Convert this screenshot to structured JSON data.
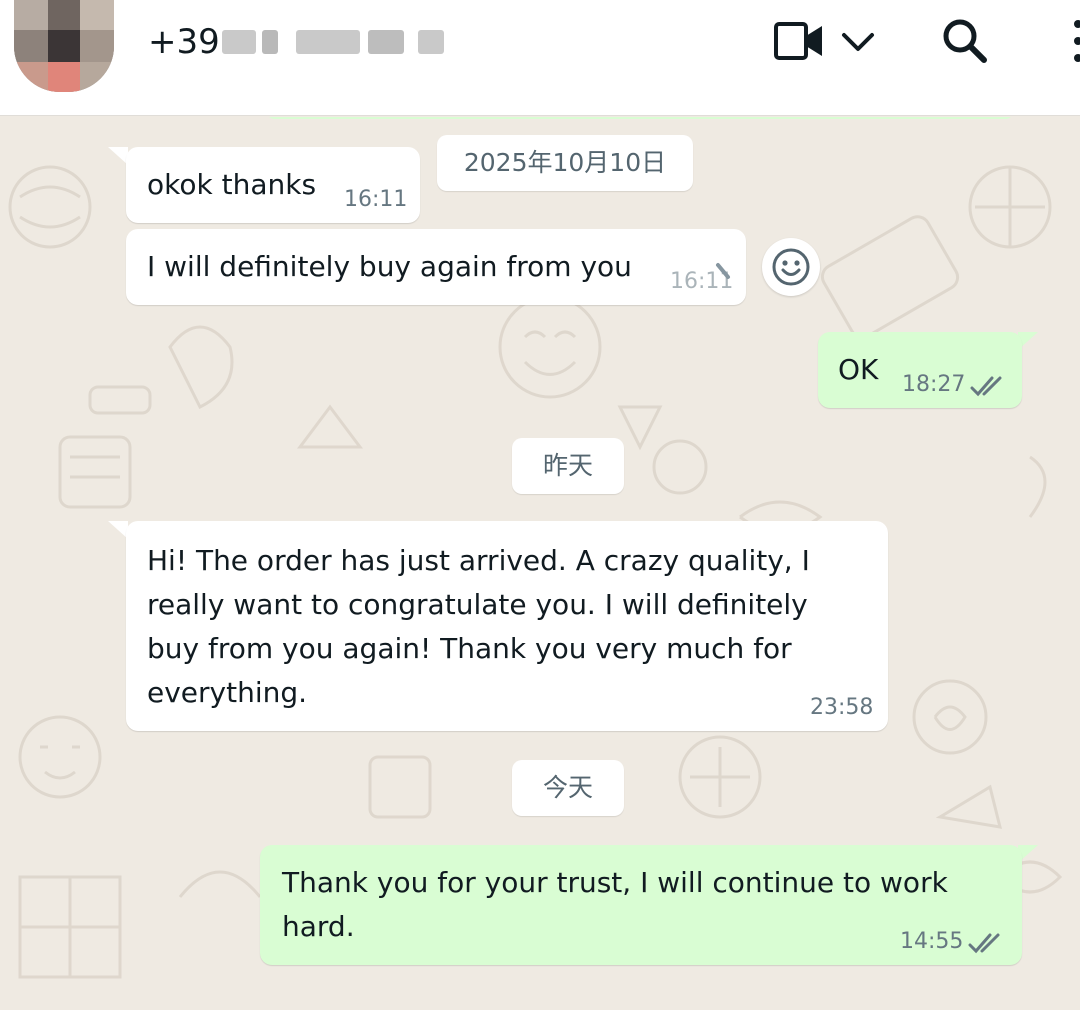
{
  "header": {
    "phone_prefix": "+39",
    "icons": [
      "video-call-icon",
      "chevron-down-icon",
      "search-icon",
      "more-options-icon"
    ]
  },
  "date_separators": {
    "first": "2025年10月10日",
    "second": "昨天",
    "third": "今天"
  },
  "messages": [
    {
      "direction": "incoming",
      "text": "okok thanks",
      "time": "16:11"
    },
    {
      "direction": "incoming",
      "text": "I will definitely buy again from you",
      "time": "16:11"
    },
    {
      "direction": "outgoing",
      "text": "OK",
      "time": "18:27",
      "status": "read"
    },
    {
      "direction": "incoming",
      "text": "Hi! The order has just arrived. A crazy quality, I\nreally want to congratulate you. I will definitely\nbuy from you again! Thank you very much for\neverything.",
      "time": "23:58"
    },
    {
      "direction": "outgoing",
      "text": "Thank you for your trust, I will continue to work\nhard.",
      "time": "14:55",
      "status": "read"
    }
  ],
  "colors": {
    "chat_background": "#efeae2",
    "incoming_bubble": "#ffffff",
    "outgoing_bubble": "#d9fdd3",
    "read_tick": "#667781"
  }
}
